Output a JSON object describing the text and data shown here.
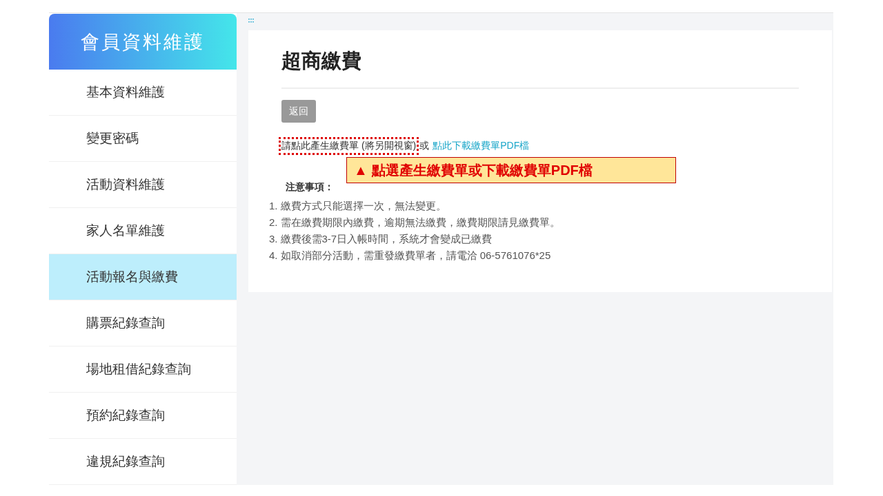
{
  "sidebar": {
    "title": "會員資料維護",
    "items": [
      {
        "label": "基本資料維護",
        "selected": false
      },
      {
        "label": "變更密碼",
        "selected": false
      },
      {
        "label": "活動資料維護",
        "selected": false
      },
      {
        "label": "家人名單維護",
        "selected": false
      },
      {
        "label": "活動報名與繳費",
        "selected": true
      },
      {
        "label": "購票紀錄查詢",
        "selected": false
      },
      {
        "label": "場地租借紀錄查詢",
        "selected": false
      },
      {
        "label": "預約紀錄查詢",
        "selected": false
      },
      {
        "label": "違規紀錄查詢",
        "selected": false
      }
    ]
  },
  "main": {
    "title": "超商繳費",
    "back_button": "返回",
    "generate_link": {
      "text": "請點此產生繳費單 (將另開視窗)",
      "highlighted": true
    },
    "separator": "或",
    "download_link": "點此下載繳費單PDF檔",
    "callout": {
      "icon": "▲",
      "text": "點選產生繳費單或下載繳費單PDF檔"
    },
    "notes_title": "注意事項：",
    "notes": [
      {
        "number": "1.",
        "text": "繳費方式只能選擇一次，無法變更。"
      },
      {
        "number": "2.",
        "text": "需在繳費期限內繳費，逾期無法繳費，繳費期限請見繳費單。"
      },
      {
        "number": "3.",
        "text": "繳費後需3-7日入帳時間，系統才會變成已繳費"
      },
      {
        "number": "4.",
        "text": "如取消部分活動，需重發繳費單者，請電洽 06-5761076*25"
      }
    ]
  }
}
